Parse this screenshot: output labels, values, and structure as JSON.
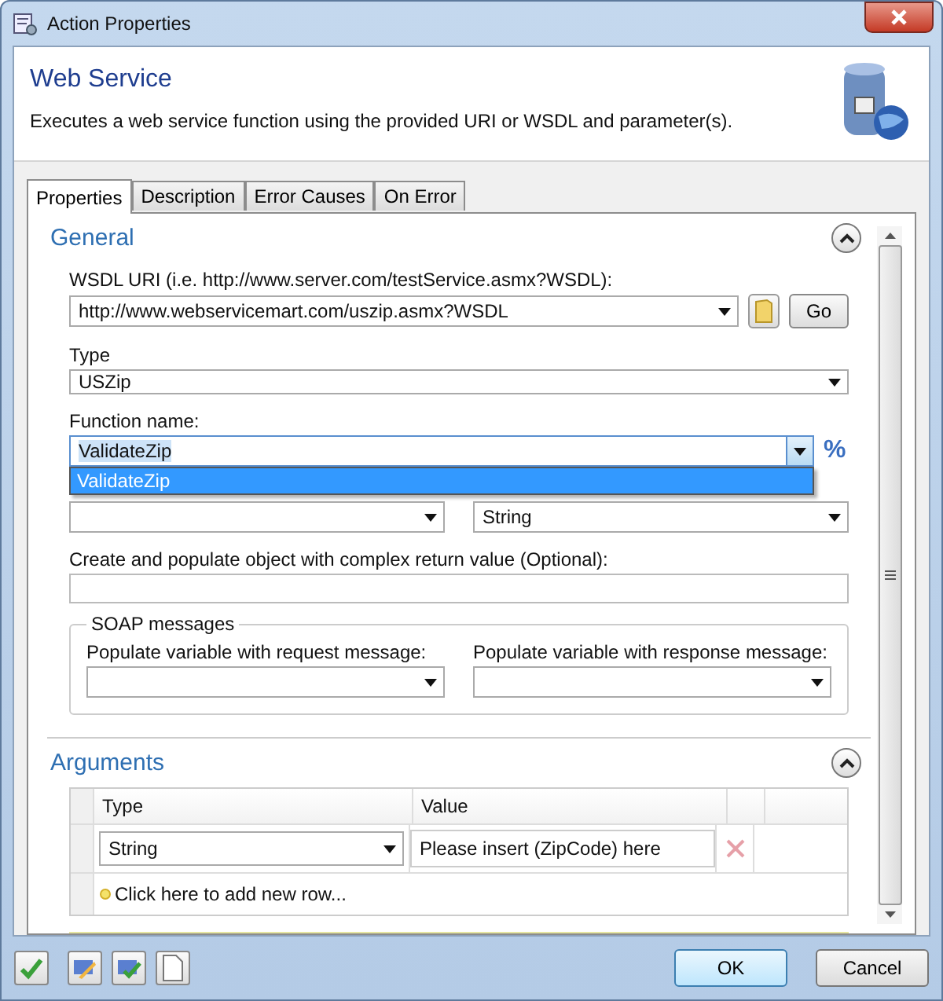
{
  "window": {
    "title": "Action Properties"
  },
  "header": {
    "title": "Web Service",
    "description": "Executes a web service function using the provided URI or WSDL and parameter(s)."
  },
  "tabs": [
    {
      "label": "Properties",
      "selected": true
    },
    {
      "label": "Description",
      "selected": false
    },
    {
      "label": "Error Causes",
      "selected": false
    },
    {
      "label": "On Error",
      "selected": false
    }
  ],
  "general": {
    "heading": "General",
    "expanded": true,
    "wsdl_label": "WSDL URI (i.e. http://www.server.com/testService.asmx?WSDL):",
    "wsdl_value": "http://www.webservicemart.com/uszip.asmx?WSDL",
    "go_button": "Go",
    "type_label": "Type",
    "type_value": "USZip",
    "function_label": "Function name:",
    "function_value": "ValidateZip",
    "function_percent": "%",
    "function_options": [
      {
        "label": "ValidateZip",
        "selected": true
      }
    ],
    "return_type_value": "String",
    "complex_label": "Create and populate object with complex return value (Optional):",
    "soap": {
      "legend": "SOAP messages",
      "request_label": "Populate variable with request message:",
      "response_label": "Populate variable with response message:"
    }
  },
  "arguments": {
    "heading": "Arguments",
    "expanded": true,
    "columns": [
      "Type",
      "Value"
    ],
    "rows": [
      {
        "type": "String",
        "value": "Please insert (ZipCode) here"
      }
    ],
    "add_row": "Click here to add new row..."
  },
  "buttons": {
    "ok": "OK",
    "cancel": "Cancel"
  }
}
